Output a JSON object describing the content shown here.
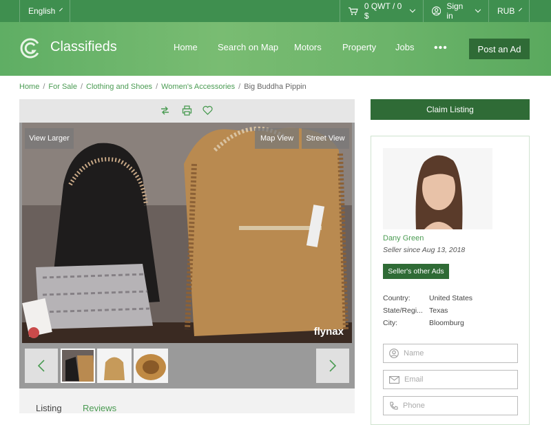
{
  "topbar": {
    "language": "English",
    "cart": "0 QWT / 0 $",
    "signin": "Sign in",
    "currency": "RUB"
  },
  "header": {
    "brand": "Classifieds",
    "nav": [
      "Home",
      "Search on Map",
      "Motors",
      "Property",
      "Jobs"
    ],
    "more": "•••",
    "post_ad": "Post an Ad"
  },
  "breadcrumbs": [
    "Home",
    "For Sale",
    "Clothing and Shoes",
    "Women's Accessories",
    "Big Buddha Pippin"
  ],
  "gallery": {
    "view_larger": "View Larger",
    "map_view": "Map View",
    "street_view": "Street View",
    "watermark": "flynax"
  },
  "tabs": [
    "Listing",
    "Reviews"
  ],
  "sidebar": {
    "claim": "Claim Listing",
    "seller_name": "Dany Green",
    "seller_since": "Seller since Aug 13, 2018",
    "other_ads": "Seller's other Ads",
    "info": [
      {
        "label": "Country:",
        "value": "United States"
      },
      {
        "label": "State/Regi...",
        "value": "Texas"
      },
      {
        "label": "City:",
        "value": "Bloomburg"
      }
    ],
    "form": {
      "name_placeholder": "Name",
      "email_placeholder": "Email",
      "phone_placeholder": "Phone"
    }
  },
  "colors": {
    "topbar": "#3f8f4f",
    "accent": "#2f6b36",
    "link": "#4a9b52"
  }
}
